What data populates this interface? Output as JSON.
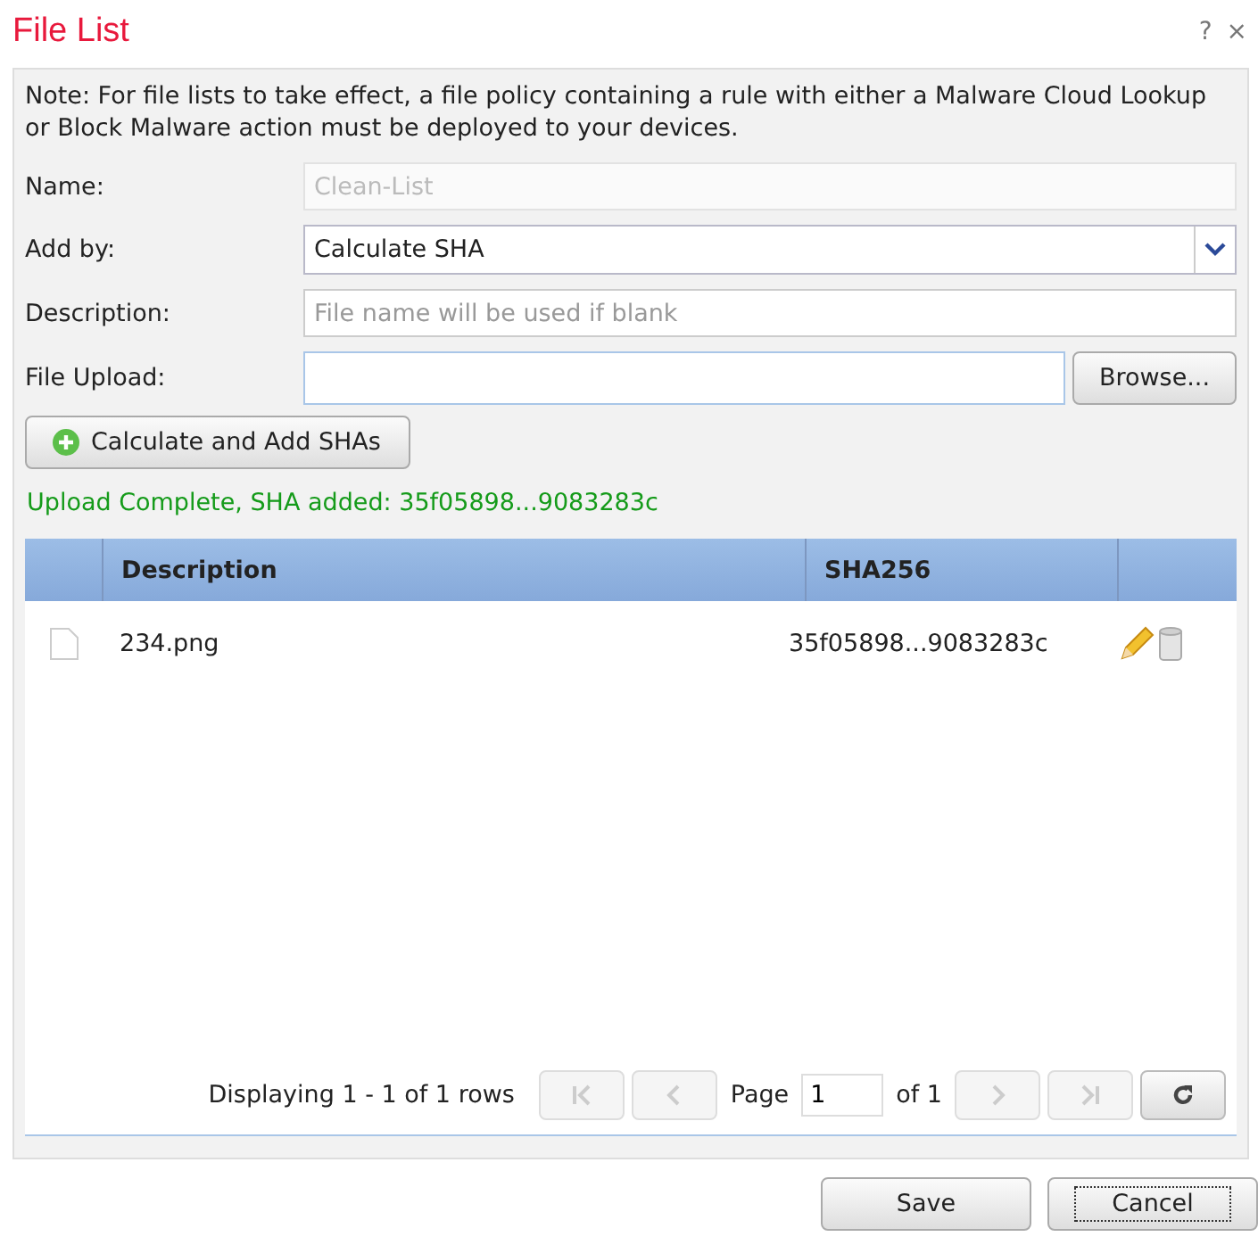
{
  "window": {
    "title": "File List",
    "help": "?",
    "close": "×"
  },
  "note": "Note: For file lists to take effect, a file policy containing a rule with either a Malware Cloud Lookup or Block Malware action must be deployed to your devices.",
  "fields": [
    {
      "kind": "text",
      "label": "Name:",
      "value": "Clean-List",
      "disabled": true
    },
    {
      "kind": "select",
      "label": "Add by:",
      "value": "Calculate SHA"
    },
    {
      "kind": "text",
      "label": "Description:",
      "placeholder": "File name will be used if blank",
      "disabled": false
    },
    {
      "kind": "file",
      "label": "File Upload:",
      "button": "Browse..."
    }
  ],
  "action_button": "Calculate and Add SHAs",
  "status": "Upload Complete, SHA added: 35f05898...9083283c",
  "table": {
    "columns": [
      "Description",
      "SHA256"
    ],
    "rows": [
      {
        "description": "234.png",
        "sha256": "35f05898...9083283c"
      }
    ]
  },
  "pager": {
    "summary": "Displaying 1 - 1 of 1 rows",
    "page_label": "Page",
    "page": "1",
    "of": "of 1",
    "buttons": [
      {
        "kind": "first",
        "disabled": true
      },
      {
        "kind": "prev",
        "disabled": true
      },
      {
        "kind": "next",
        "disabled": true
      },
      {
        "kind": "last",
        "disabled": true
      },
      {
        "kind": "refresh",
        "disabled": false
      }
    ]
  },
  "buttons": [
    {
      "label": "Save",
      "focused": false
    },
    {
      "label": "Cancel",
      "focused": true
    }
  ]
}
